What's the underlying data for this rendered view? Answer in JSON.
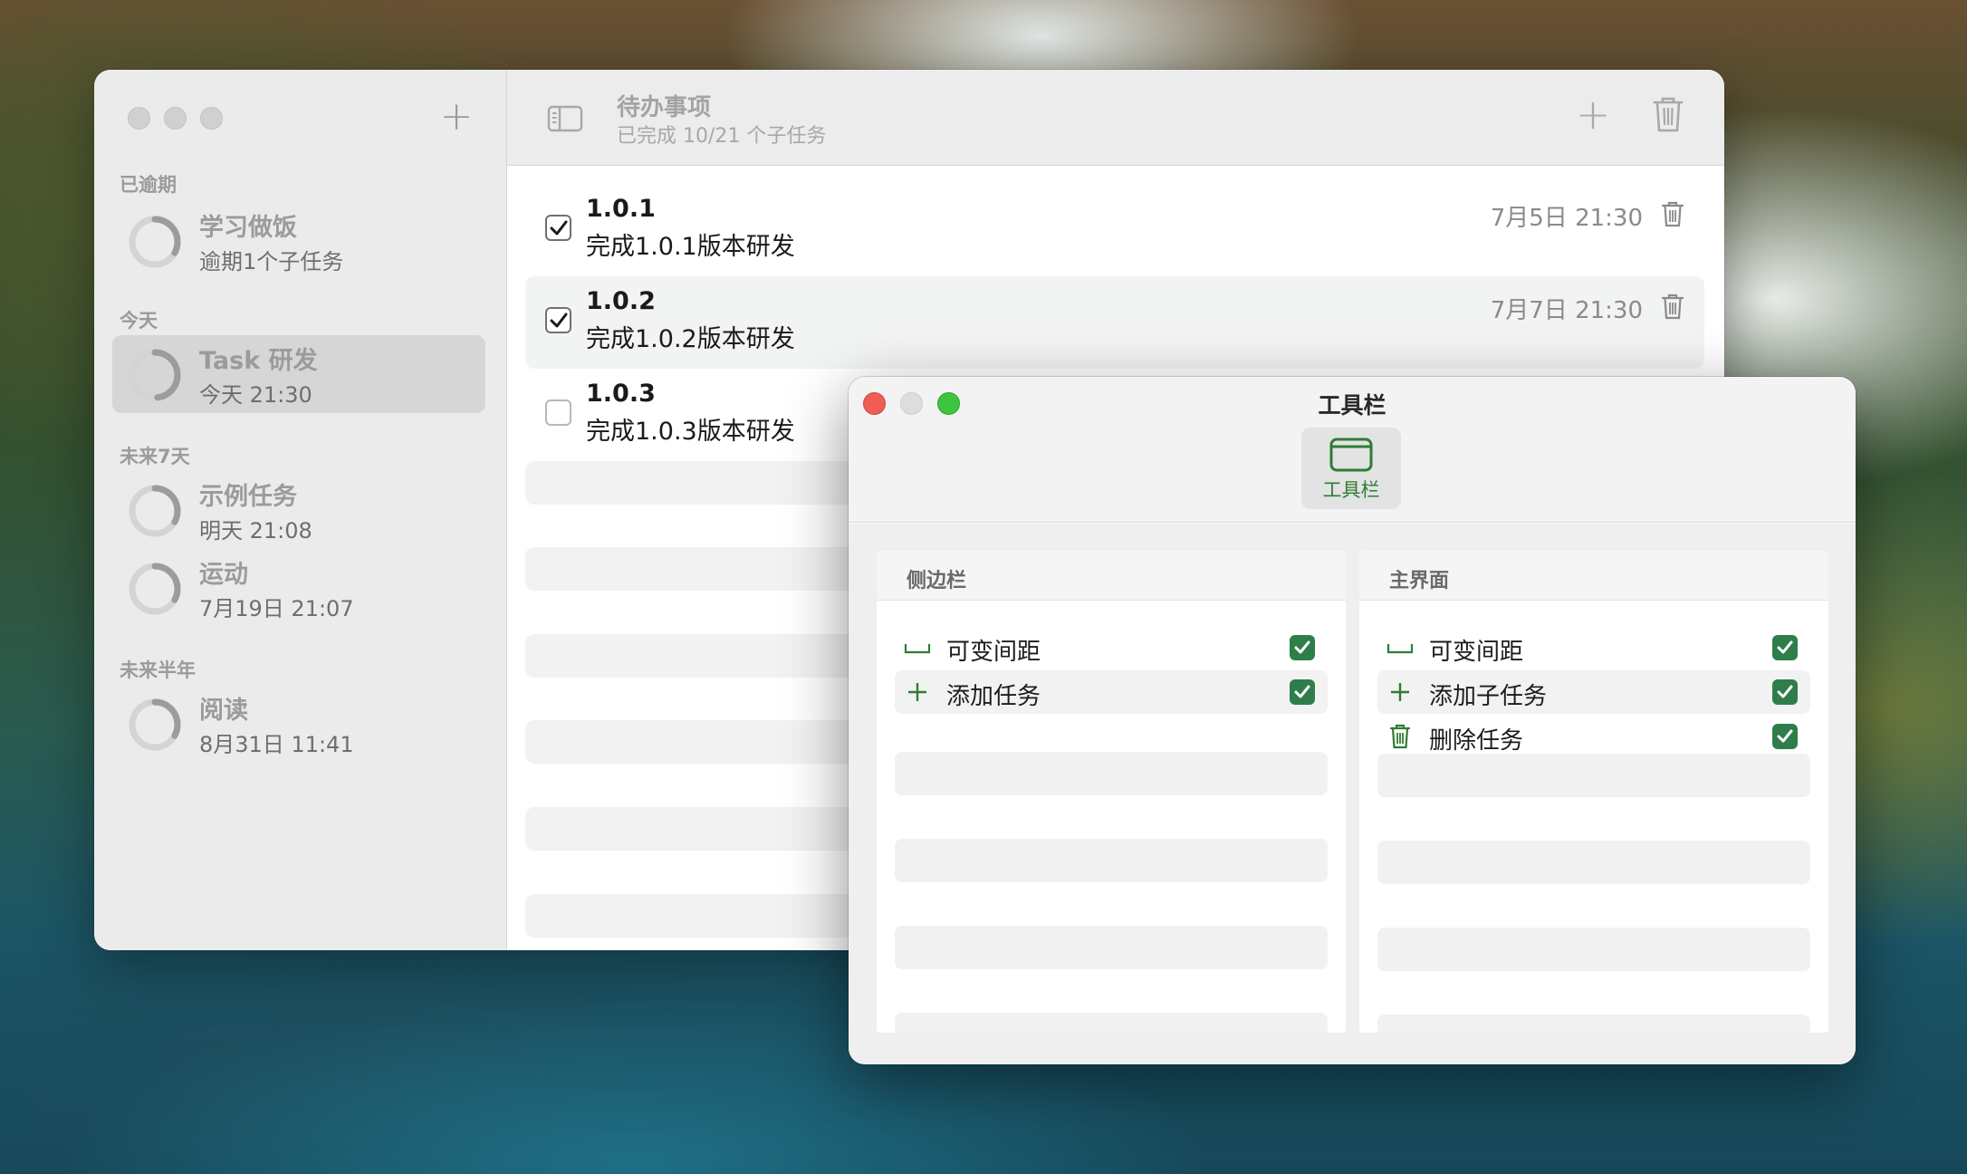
{
  "main_window": {
    "sidebar": {
      "add_label": "+",
      "sections": [
        {
          "title": "已逾期",
          "items": [
            {
              "title": "学习做饭",
              "subtitle": "逾期1个子任务",
              "progress": 0.33,
              "selected": false
            }
          ]
        },
        {
          "title": "今天",
          "items": [
            {
              "title": "Task 研发",
              "subtitle": "今天 21:30",
              "progress": 0.48,
              "selected": true
            }
          ]
        },
        {
          "title": "未来7天",
          "items": [
            {
              "title": "示例任务",
              "subtitle": "明天 21:08",
              "progress": 0.33,
              "selected": false
            },
            {
              "title": "运动",
              "subtitle": "7月19日 21:07",
              "progress": 0.33,
              "selected": false
            }
          ]
        },
        {
          "title": "未来半年",
          "items": [
            {
              "title": "阅读",
              "subtitle": "8月31日 11:41",
              "progress": 0.33,
              "selected": false
            }
          ]
        }
      ]
    },
    "toolbar": {
      "title": "待办事项",
      "subtitle": "已完成 10/21 个子任务",
      "add_label": "+",
      "toggle_icon": "sidebar-toggle-icon",
      "trash_icon": "trash-icon"
    },
    "tasks": [
      {
        "name": "1.0.1",
        "desc": "完成1.0.1版本研发",
        "date": "7月5日 21:30",
        "done": true
      },
      {
        "name": "1.0.2",
        "desc": "完成1.0.2版本研发",
        "date": "7月7日 21:30",
        "done": true
      },
      {
        "name": "1.0.3",
        "desc": "完成1.0.3版本研发",
        "date": "",
        "done": false
      }
    ]
  },
  "pref_window": {
    "title": "工具栏",
    "tab": {
      "label": "工具栏",
      "icon": "window-icon"
    },
    "panels": {
      "sidebar": {
        "title": "侧边栏",
        "items": [
          {
            "label": "可变间距",
            "icon": "space-icon",
            "checked": true
          },
          {
            "label": "添加任务",
            "icon": "plus-icon",
            "checked": true
          }
        ]
      },
      "main": {
        "title": "主界面",
        "items": [
          {
            "label": "可变间距",
            "icon": "space-icon",
            "checked": true
          },
          {
            "label": "添加子任务",
            "icon": "plus-icon",
            "checked": true
          },
          {
            "label": "删除任务",
            "icon": "trash-icon",
            "checked": true
          }
        ]
      }
    },
    "colors": {
      "accent": "#2f7e49",
      "close": "#ee5e57",
      "zoom": "#3ec53f"
    }
  }
}
